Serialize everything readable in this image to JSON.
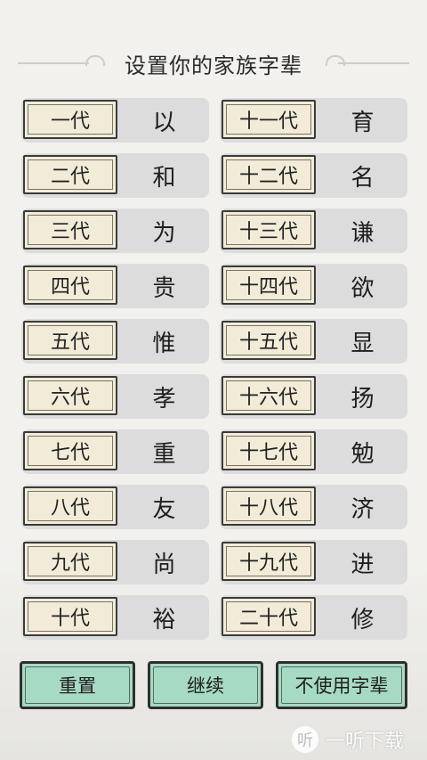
{
  "title": "设置你的家族字辈",
  "generations": [
    {
      "label": "一代",
      "char": "以"
    },
    {
      "label": "十一代",
      "char": "育"
    },
    {
      "label": "二代",
      "char": "和"
    },
    {
      "label": "十二代",
      "char": "名"
    },
    {
      "label": "三代",
      "char": "为"
    },
    {
      "label": "十三代",
      "char": "谦"
    },
    {
      "label": "四代",
      "char": "贵"
    },
    {
      "label": "十四代",
      "char": "欲"
    },
    {
      "label": "五代",
      "char": "惟"
    },
    {
      "label": "十五代",
      "char": "显"
    },
    {
      "label": "六代",
      "char": "孝"
    },
    {
      "label": "十六代",
      "char": "扬"
    },
    {
      "label": "七代",
      "char": "重"
    },
    {
      "label": "十七代",
      "char": "勉"
    },
    {
      "label": "八代",
      "char": "友"
    },
    {
      "label": "十八代",
      "char": "济"
    },
    {
      "label": "九代",
      "char": "尚"
    },
    {
      "label": "十九代",
      "char": "进"
    },
    {
      "label": "十代",
      "char": "裕"
    },
    {
      "label": "二十代",
      "char": "修"
    }
  ],
  "buttons": {
    "reset": "重置",
    "continue": "继续",
    "skip": "不使用字辈"
  },
  "watermark": {
    "logo": "听",
    "text": "一听下载"
  },
  "colors": {
    "button_bg": "#a7dac3",
    "label_bg": "#f1ebd8",
    "cell_bg": "#dcdcdc"
  }
}
